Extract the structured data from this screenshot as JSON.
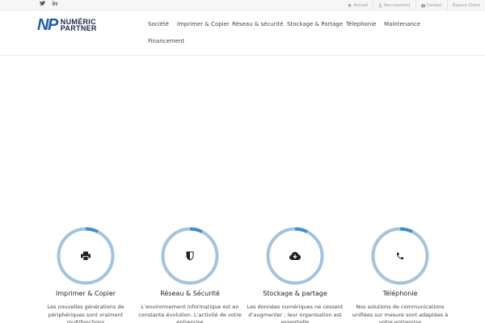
{
  "topbar": {
    "social": [
      "twitter-icon",
      "linkedin-icon"
    ],
    "links": [
      {
        "label": "Accueil",
        "icon": "home-icon"
      },
      {
        "label": "Recrutement",
        "icon": "user-icon"
      },
      {
        "label": "Contact",
        "icon": "envelope-icon"
      },
      {
        "label": "Espace Client",
        "icon": ""
      }
    ]
  },
  "logo": {
    "mark": "NP",
    "line1": "NUMÉRIC",
    "line2": "PARTNER"
  },
  "nav": {
    "items": [
      "Société",
      "Imprimer & Copier",
      "Réseau & sécurité",
      "Stockage & Partage",
      "Télephonie",
      "Maintenance",
      "Financement"
    ]
  },
  "features": [
    {
      "title": "Imprimer & Copier",
      "icon": "printer-icon",
      "desc": "Les nouvelles générations de périphériques sont vraiment multifonctions"
    },
    {
      "title": "Réseau & Sécurité",
      "icon": "shield-icon",
      "desc": "L’environnement informatique est en constante évolution. L’activité de votre entreprise"
    },
    {
      "title": "Stockage & partage",
      "icon": "cloud-download-icon",
      "desc": "Les données numériques ne cessent d’augmenter ; leur organisation est essentielle"
    },
    {
      "title": "Téléphonie",
      "icon": "phone-icon",
      "desc": "Nos solutions de communications unifiées sur mesure sont adaptées à votre entreprise"
    }
  ],
  "colors": {
    "brand": "#1f5fa8",
    "ring": "#a3c4dd",
    "ring_accent": "#3f8fd0"
  }
}
